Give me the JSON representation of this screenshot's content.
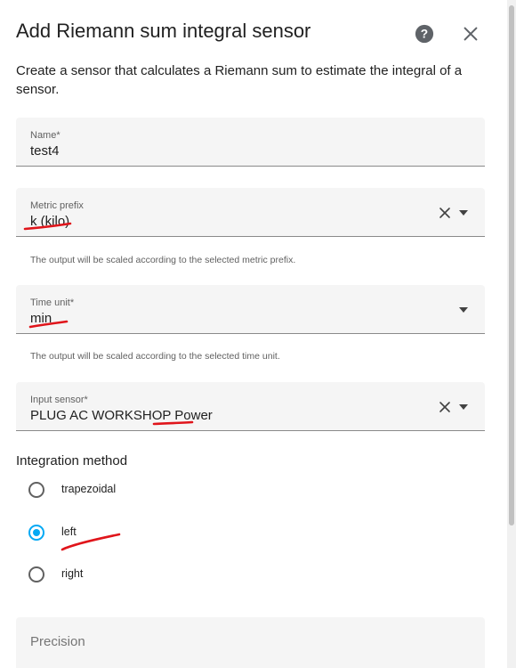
{
  "dialog": {
    "title": "Add Riemann sum integral sensor",
    "description": "Create a sensor that calculates a Riemann sum to estimate the integral of a sensor.",
    "help_icon": "help-circle-icon",
    "close_icon": "close-icon"
  },
  "fields": {
    "name": {
      "label": "Name*",
      "value": "test4"
    },
    "metric_prefix": {
      "label": "Metric prefix",
      "value": "k (kilo)",
      "helper": "The output will be scaled according to the selected metric prefix."
    },
    "time_unit": {
      "label": "Time unit*",
      "value": "min",
      "helper": "The output will be scaled according to the selected time unit."
    },
    "input_sensor": {
      "label": "Input sensor*",
      "value": "PLUG AC WORKSHOP Power"
    },
    "precision": {
      "placeholder": "Precision"
    }
  },
  "integration_method": {
    "title": "Integration method",
    "options": [
      {
        "label": "trapezoidal",
        "checked": false
      },
      {
        "label": "left",
        "checked": true
      },
      {
        "label": "right",
        "checked": false
      }
    ]
  },
  "colors": {
    "accent": "#03a9f4",
    "field_bg": "#f5f5f5",
    "annotation": "#e0151b"
  }
}
